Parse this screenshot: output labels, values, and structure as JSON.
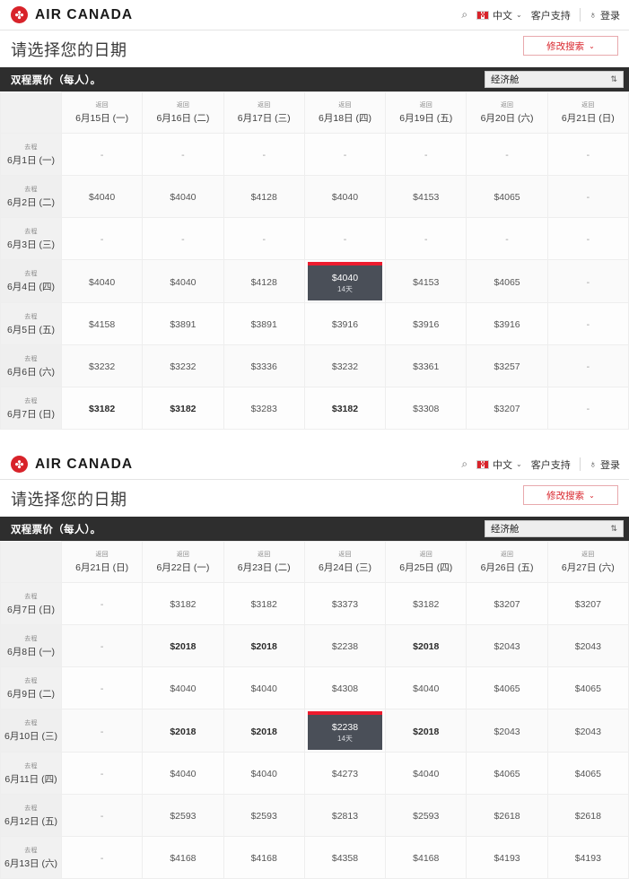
{
  "header": {
    "brand_name": "AIR CANADA",
    "search_icon": "search-icon",
    "flag_glyph": "✤",
    "language": "中文",
    "support": "客户支持",
    "login": "登录",
    "person_icon": "♁",
    "caret": "⌄"
  },
  "title": {
    "heading": "请选择您的日期",
    "modify_search": "修改搜索",
    "modify_caret": "⌄"
  },
  "fare_bar": {
    "label": "双程票价（每人）。",
    "cabin": "经济舱",
    "spinner": "⇅"
  },
  "labels": {
    "return_prefix": "返回",
    "depart_prefix": "去程",
    "empty_cell": "-",
    "days_badge": "14天"
  },
  "chart_data": [
    {
      "type": "table",
      "title": "双程票价（每人）。",
      "columns": [
        "6月15日 (一)",
        "6月16日 (二)",
        "6月17日 (三)",
        "6月18日 (四)",
        "6月19日 (五)",
        "6月20日 (六)",
        "6月21日 (日)"
      ],
      "rows": [
        {
          "label": "6月1日 (一)",
          "cells": [
            {
              "text": "-",
              "state": "empty"
            },
            {
              "text": "-",
              "state": "empty"
            },
            {
              "text": "-",
              "state": "empty"
            },
            {
              "text": "-",
              "state": "empty"
            },
            {
              "text": "-",
              "state": "empty"
            },
            {
              "text": "-",
              "state": "empty"
            },
            {
              "text": "-",
              "state": "empty"
            }
          ]
        },
        {
          "label": "6月2日 (二)",
          "cells": [
            {
              "text": "$4040",
              "state": "normal"
            },
            {
              "text": "$4040",
              "state": "normal"
            },
            {
              "text": "$4128",
              "state": "normal"
            },
            {
              "text": "$4040",
              "state": "normal"
            },
            {
              "text": "$4153",
              "state": "normal"
            },
            {
              "text": "$4065",
              "state": "normal"
            },
            {
              "text": "-",
              "state": "empty"
            }
          ]
        },
        {
          "label": "6月3日 (三)",
          "cells": [
            {
              "text": "-",
              "state": "empty"
            },
            {
              "text": "-",
              "state": "empty"
            },
            {
              "text": "-",
              "state": "empty"
            },
            {
              "text": "-",
              "state": "empty"
            },
            {
              "text": "-",
              "state": "empty"
            },
            {
              "text": "-",
              "state": "empty"
            },
            {
              "text": "-",
              "state": "empty"
            }
          ]
        },
        {
          "label": "6月4日 (四)",
          "cells": [
            {
              "text": "$4040",
              "state": "normal"
            },
            {
              "text": "$4040",
              "state": "normal"
            },
            {
              "text": "$4128",
              "state": "normal"
            },
            {
              "text": "$4040",
              "state": "selected",
              "days": "14天"
            },
            {
              "text": "$4153",
              "state": "normal"
            },
            {
              "text": "$4065",
              "state": "normal"
            },
            {
              "text": "-",
              "state": "empty"
            }
          ]
        },
        {
          "label": "6月5日 (五)",
          "cells": [
            {
              "text": "$4158",
              "state": "normal"
            },
            {
              "text": "$3891",
              "state": "normal"
            },
            {
              "text": "$3891",
              "state": "normal"
            },
            {
              "text": "$3916",
              "state": "normal"
            },
            {
              "text": "$3916",
              "state": "normal"
            },
            {
              "text": "$3916",
              "state": "normal"
            },
            {
              "text": "-",
              "state": "empty"
            }
          ]
        },
        {
          "label": "6月6日 (六)",
          "cells": [
            {
              "text": "$3232",
              "state": "normal"
            },
            {
              "text": "$3232",
              "state": "normal"
            },
            {
              "text": "$3336",
              "state": "normal"
            },
            {
              "text": "$3232",
              "state": "normal"
            },
            {
              "text": "$3361",
              "state": "normal"
            },
            {
              "text": "$3257",
              "state": "normal"
            },
            {
              "text": "-",
              "state": "empty"
            }
          ]
        },
        {
          "label": "6月7日 (日)",
          "cells": [
            {
              "text": "$3182",
              "state": "best"
            },
            {
              "text": "$3182",
              "state": "best"
            },
            {
              "text": "$3283",
              "state": "normal"
            },
            {
              "text": "$3182",
              "state": "best"
            },
            {
              "text": "$3308",
              "state": "normal"
            },
            {
              "text": "$3207",
              "state": "normal"
            },
            {
              "text": "-",
              "state": "empty"
            }
          ]
        }
      ]
    },
    {
      "type": "table",
      "title": "双程票价（每人）。",
      "columns": [
        "6月21日 (日)",
        "6月22日 (一)",
        "6月23日 (二)",
        "6月24日 (三)",
        "6月25日 (四)",
        "6月26日 (五)",
        "6月27日 (六)"
      ],
      "rows": [
        {
          "label": "6月7日 (日)",
          "cells": [
            {
              "text": "-",
              "state": "empty"
            },
            {
              "text": "$3182",
              "state": "normal"
            },
            {
              "text": "$3182",
              "state": "normal"
            },
            {
              "text": "$3373",
              "state": "normal"
            },
            {
              "text": "$3182",
              "state": "normal"
            },
            {
              "text": "$3207",
              "state": "normal"
            },
            {
              "text": "$3207",
              "state": "normal"
            }
          ]
        },
        {
          "label": "6月8日 (一)",
          "cells": [
            {
              "text": "-",
              "state": "empty"
            },
            {
              "text": "$2018",
              "state": "best"
            },
            {
              "text": "$2018",
              "state": "best"
            },
            {
              "text": "$2238",
              "state": "normal"
            },
            {
              "text": "$2018",
              "state": "best"
            },
            {
              "text": "$2043",
              "state": "normal"
            },
            {
              "text": "$2043",
              "state": "normal"
            }
          ]
        },
        {
          "label": "6月9日 (二)",
          "cells": [
            {
              "text": "-",
              "state": "empty"
            },
            {
              "text": "$4040",
              "state": "normal"
            },
            {
              "text": "$4040",
              "state": "normal"
            },
            {
              "text": "$4308",
              "state": "normal"
            },
            {
              "text": "$4040",
              "state": "normal"
            },
            {
              "text": "$4065",
              "state": "normal"
            },
            {
              "text": "$4065",
              "state": "normal"
            }
          ]
        },
        {
          "label": "6月10日 (三)",
          "cells": [
            {
              "text": "-",
              "state": "empty"
            },
            {
              "text": "$2018",
              "state": "best"
            },
            {
              "text": "$2018",
              "state": "best"
            },
            {
              "text": "$2238",
              "state": "selected",
              "days": "14天"
            },
            {
              "text": "$2018",
              "state": "best"
            },
            {
              "text": "$2043",
              "state": "normal"
            },
            {
              "text": "$2043",
              "state": "normal"
            }
          ]
        },
        {
          "label": "6月11日 (四)",
          "cells": [
            {
              "text": "-",
              "state": "empty"
            },
            {
              "text": "$4040",
              "state": "normal"
            },
            {
              "text": "$4040",
              "state": "normal"
            },
            {
              "text": "$4273",
              "state": "normal"
            },
            {
              "text": "$4040",
              "state": "normal"
            },
            {
              "text": "$4065",
              "state": "normal"
            },
            {
              "text": "$4065",
              "state": "normal"
            }
          ]
        },
        {
          "label": "6月12日 (五)",
          "cells": [
            {
              "text": "-",
              "state": "empty"
            },
            {
              "text": "$2593",
              "state": "normal"
            },
            {
              "text": "$2593",
              "state": "normal"
            },
            {
              "text": "$2813",
              "state": "normal"
            },
            {
              "text": "$2593",
              "state": "normal"
            },
            {
              "text": "$2618",
              "state": "normal"
            },
            {
              "text": "$2618",
              "state": "normal"
            }
          ]
        },
        {
          "label": "6月13日 (六)",
          "cells": [
            {
              "text": "-",
              "state": "empty"
            },
            {
              "text": "$4168",
              "state": "normal"
            },
            {
              "text": "$4168",
              "state": "normal"
            },
            {
              "text": "$4358",
              "state": "normal"
            },
            {
              "text": "$4168",
              "state": "normal"
            },
            {
              "text": "$4193",
              "state": "normal"
            },
            {
              "text": "$4193",
              "state": "normal"
            }
          ]
        }
      ]
    }
  ],
  "colors": {
    "brand_red": "#D8232A",
    "accent_red": "#ED1B2E",
    "selected_bg": "#4a4f58",
    "bar_bg": "#2e2e2e"
  }
}
